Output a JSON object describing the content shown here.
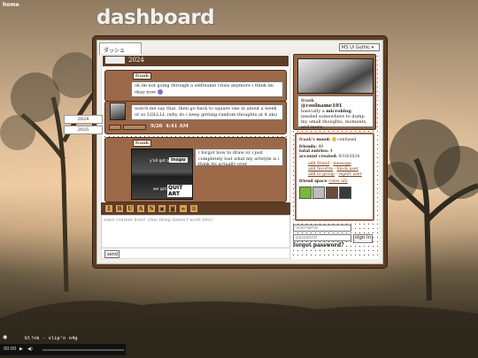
{
  "header": {
    "home_link": "home",
    "title": "dashboard"
  },
  "tab": {
    "label": "ダッシュ"
  },
  "font_select": {
    "value": "MS UI Gothic"
  },
  "year_bar": {
    "year": "2024"
  },
  "side_years": [
    "2024",
    "2025"
  ],
  "posts": [
    {
      "name": "frank",
      "text": "ok im not going through a self/name crisis anymore i think im okay now"
    },
    {
      "text": "watch me say that, then go back to square one in about a week or so LOLLLL (why do i keep getting random thoughts at 4 am)",
      "date": "9/26",
      "time": "4:41 AM"
    },
    {
      "name": "frank",
      "text": "i forgot how to draw or i just completely lost what my artstyle is i think its actually over",
      "image_caption_1": "y'all got any",
      "image_caption_2": "inspo",
      "image_caption_3": "we got",
      "image_caption_4": "QUIT ART"
    }
  ],
  "toolbar": {
    "buttons": [
      "I",
      "B",
      "U",
      "A",
      "S"
    ]
  },
  "compose": {
    "placeholder": "send content here! (this thing doesn't work btw)"
  },
  "send_button": {
    "label": "send"
  },
  "profile": {
    "name": "frank",
    "handle": "@coolname101",
    "bio_prefix": "basically a ",
    "bio_bold": "microblog",
    "bio_suffix": ". needed somewhere to dump my small thoughts, moments, and more."
  },
  "info": {
    "mood_label": "frank's",
    "mood_word": "mood:",
    "mood_value": "confused",
    "friends_label": "friends:",
    "friends_value": "49",
    "entries_label": "total entries:",
    "entries_value": "4",
    "created_label": "account created:",
    "created_value": "9/10/2024",
    "links": [
      "add friend",
      "message",
      "add favorite",
      "block user",
      "add to group",
      "report user"
    ],
    "friend_space_label": "friend space",
    "view_all": "(view all)"
  },
  "login": {
    "username_placeholder": "username",
    "password_placeholder": "password",
    "signin_label": "sign in",
    "forgot_label": "forgot password?"
  },
  "music": {
    "track_name": "bl!nk - slip'n n4g",
    "time": "00:00"
  }
}
